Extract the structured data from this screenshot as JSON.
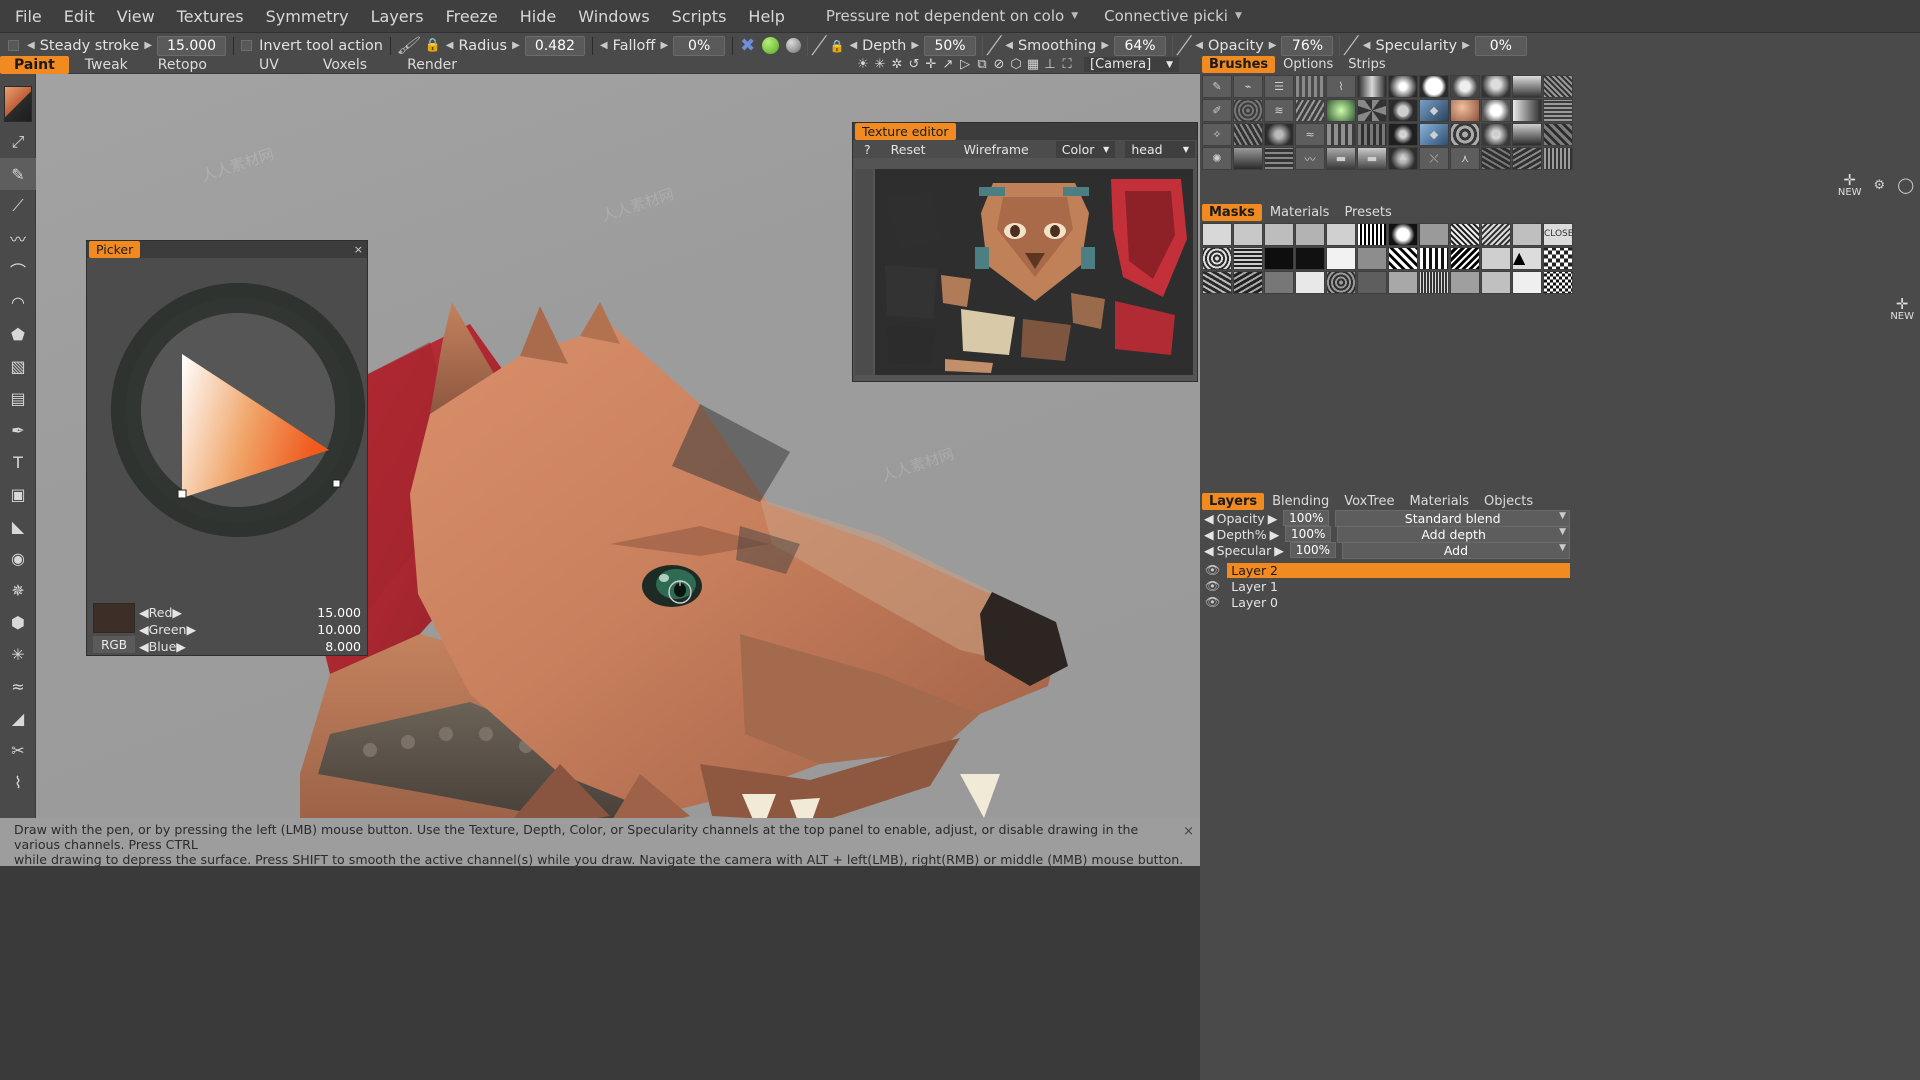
{
  "menubar": {
    "items": [
      "File",
      "Edit",
      "View",
      "Textures",
      "Symmetry",
      "Layers",
      "Freeze",
      "Hide",
      "Windows",
      "Scripts",
      "Help"
    ],
    "pressure_label": "Pressure not dependent on colo",
    "connective_label": "Connective picki"
  },
  "optionsbar": {
    "steady_stroke_label": "Steady stroke",
    "steady_stroke_value": "15.000",
    "invert_tool_label": "Invert tool action",
    "radius_label": "Radius",
    "radius_value": "0.482",
    "falloff_label": "Falloff",
    "falloff_value": "0%",
    "depth_label": "Depth",
    "depth_value": "50%",
    "smoothing_label": "Smoothing",
    "smoothing_value": "64%",
    "opacity_label": "Opacity",
    "opacity_value": "76%",
    "specularity_label": "Specularity",
    "specularity_value": "0%"
  },
  "tabs": {
    "items": [
      "Paint",
      "Tweak",
      "Retopo",
      "UV",
      "Voxels",
      "Render"
    ],
    "active": "Paint"
  },
  "camera": {
    "selected": "[Camera]",
    "icons": [
      "light-icon",
      "light2-icon",
      "light3-icon",
      "undo-icon",
      "redo-icon",
      "snap-icon",
      "play-icon",
      "object-icon",
      "no-icon",
      "cube-icon",
      "grid-icon",
      "axis-icon",
      "fullscreen-icon"
    ]
  },
  "left_tools": {
    "icons": [
      "color-swatch",
      "cursor-icon",
      "brush-icon",
      "line-icon",
      "stroke-icon",
      "curve-icon",
      "spline-icon",
      "stamp-icon",
      "fill-icon",
      "copy-icon",
      "pen-icon",
      "text-icon",
      "layer-icon",
      "eraser-icon",
      "eye-icon",
      "gear-icon",
      "cube-icon",
      "sparkle-icon",
      "wave-icon",
      "smear-icon",
      "scissors-icon",
      "comb-icon"
    ]
  },
  "picker": {
    "title": "Picker",
    "close": "×",
    "rgb_button": "RGB",
    "fields": [
      {
        "name": "Red",
        "value": "15.000"
      },
      {
        "name": "Green",
        "value": "10.000"
      },
      {
        "name": "Blue",
        "value": "8.000"
      }
    ],
    "current_color": "#3d2f27"
  },
  "texture_editor": {
    "title": "Texture editor",
    "help": "?",
    "reset": "Reset",
    "wireframe": "Wireframe",
    "color_select": "Color",
    "mesh_select": "head"
  },
  "right_panel": {
    "brush_tabs": [
      "Brushes",
      "Options",
      "Strips"
    ],
    "brush_tabs_active": "Brushes",
    "mask_tabs": [
      "Masks",
      "Materials",
      "Presets"
    ],
    "mask_tabs_active": "Masks",
    "new_label": "NEW",
    "close_label": "CLOSE",
    "layer_tabs": [
      "Layers",
      "Blending",
      "VoxTree",
      "Materials",
      "Objects"
    ],
    "layer_tabs_active": "Layers",
    "controls": [
      {
        "name": "Opacity",
        "value": "100%",
        "mode": "Standard blend"
      },
      {
        "name": "Depth%",
        "value": "100%",
        "mode": "Add depth"
      },
      {
        "name": "Specular",
        "value": "100%",
        "mode": "Add"
      }
    ],
    "layers": [
      {
        "name": "Layer 2",
        "visible": true,
        "active": true
      },
      {
        "name": "Layer 1",
        "visible": true,
        "active": false
      },
      {
        "name": "Layer 0",
        "visible": true,
        "active": false
      }
    ]
  },
  "status": {
    "line1": "Draw with the pen, or by pressing the left (LMB) mouse button. Use the Texture, Depth, Color, or Specularity channels at the top panel to enable, adjust, or disable drawing in the various channels. Press CTRL",
    "line2": "while drawing to depress the surface. Press SHIFT to smooth the active channel(s) while you draw. Navigate the camera with ALT + left(LMB), right(RMB) or middle (MMB) mouse button. You can use LMB+RMB",
    "close": "×"
  },
  "colors": {
    "accent": "#f08a21",
    "panel": "#4a4a4a",
    "viewport": "#9d9d9d",
    "dark": "#3a3a3a"
  }
}
